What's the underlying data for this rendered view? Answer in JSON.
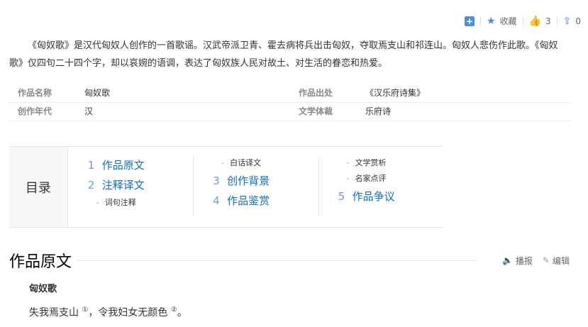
{
  "toolbar": {
    "add_icon": "plus-square-icon",
    "favorite_label": "收藏",
    "like_count": "3",
    "share_count": "0"
  },
  "summary": {
    "para1": "《匈奴歌》是汉代匈奴人创作的一首歌谣。汉武帝派卫青、霍去病将兵出击匈奴，夺取焉支山和祁连山。匈奴人悲伤作此歌。《匈奴歌》仅四句二十四个字，却以哀婉的语调，表达了匈奴族人民对故土、对生活的眷恋和热爱。"
  },
  "info": [
    {
      "key": "作品名称",
      "value": "匈奴歌",
      "key2": "作品出处",
      "value2": "《汉乐府诗集》"
    },
    {
      "key": "创作年代",
      "value": "汉",
      "key2": "文学体裁",
      "value2": "乐府诗"
    }
  ],
  "toc": {
    "label": "目录",
    "col1": [
      {
        "type": "l1",
        "num": "1",
        "text": "作品原文"
      },
      {
        "type": "l1",
        "num": "2",
        "text": "注释译文"
      },
      {
        "type": "l2",
        "text": "词句注释"
      }
    ],
    "col2": [
      {
        "type": "l2",
        "text": "白话译文"
      },
      {
        "type": "l1",
        "num": "3",
        "text": "创作背景"
      },
      {
        "type": "l1",
        "num": "4",
        "text": "作品鉴赏"
      }
    ],
    "col3": [
      {
        "type": "l2",
        "text": "文学赏析"
      },
      {
        "type": "l2",
        "text": "名家点评"
      },
      {
        "type": "l1",
        "num": "5",
        "text": "作品争议"
      }
    ]
  },
  "section": {
    "title": "作品原文",
    "report_label": "播报",
    "edit_label": "编辑"
  },
  "poem": {
    "title": "匈奴歌",
    "line1_a": "失我焉支山",
    "note1": "①",
    "line1_b": "，令我妇女无颜色",
    "note2": "②",
    "line1_c": "。"
  }
}
